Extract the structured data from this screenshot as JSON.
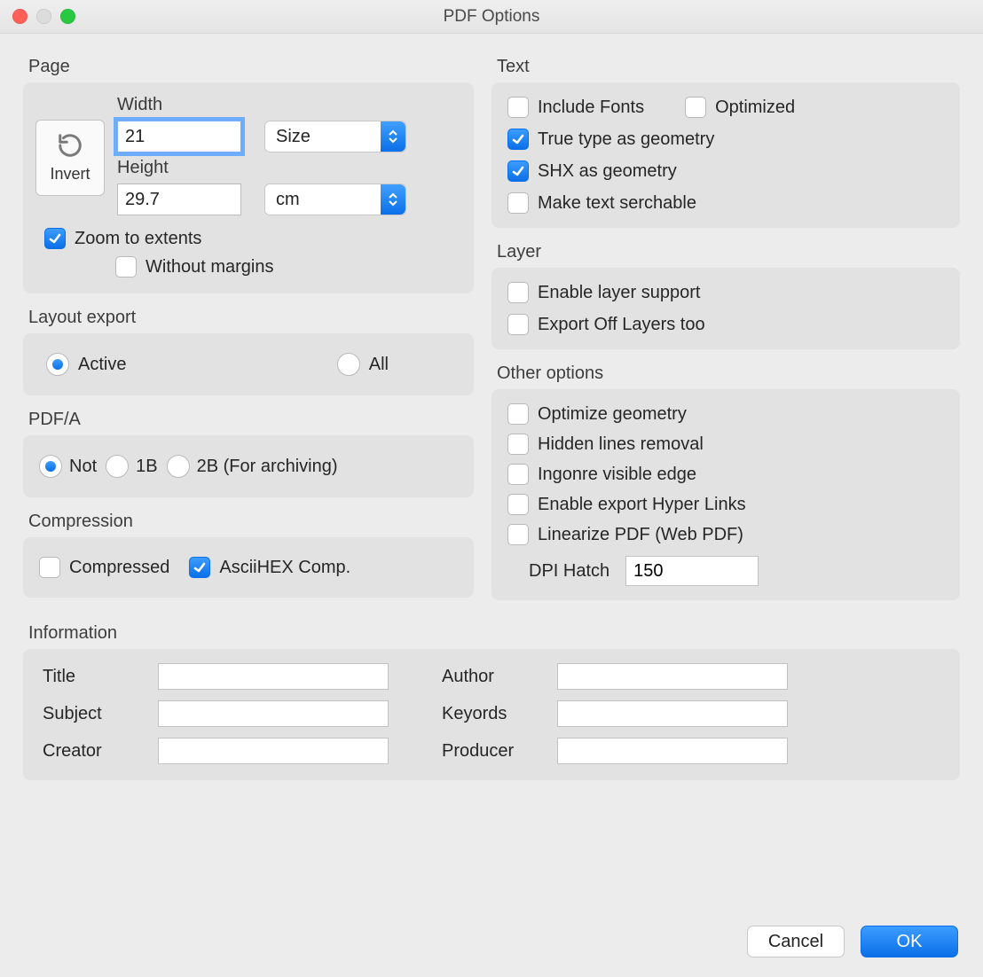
{
  "window": {
    "title": "PDF Options"
  },
  "page": {
    "section": "Page",
    "width_label": "Width",
    "height_label": "Height",
    "width_value": "21",
    "height_value": "29.7",
    "size_select": "Size",
    "unit_select": "cm",
    "invert_label": "Invert",
    "zoom_label": "Zoom to extents",
    "zoom_checked": true,
    "without_margins_label": "Without margins",
    "without_margins_checked": false
  },
  "layout_export": {
    "section": "Layout export",
    "active_label": "Active",
    "all_label": "All",
    "selected": "active"
  },
  "pdfa": {
    "section": "PDF/A",
    "not_label": "Not",
    "b1_label": "1B",
    "b2_label": "2B (For archiving)",
    "selected": "not"
  },
  "compression": {
    "section": "Compression",
    "compressed_label": "Compressed",
    "compressed_checked": false,
    "ascii_label": "AsciiHEX Comp.",
    "ascii_checked": true
  },
  "text": {
    "section": "Text",
    "include_fonts_label": "Include Fonts",
    "include_fonts_checked": false,
    "optimized_label": "Optimized",
    "optimized_checked": false,
    "ttf_label": "True type as geometry",
    "ttf_checked": true,
    "shx_label": "SHX as geometry",
    "shx_checked": true,
    "searchable_label": "Make text serchable",
    "searchable_checked": false
  },
  "layer": {
    "section": "Layer",
    "enable_label": "Enable layer support",
    "enable_checked": false,
    "export_off_label": "Export Off Layers too",
    "export_off_checked": false
  },
  "other": {
    "section": "Other options",
    "optimize_geom_label": "Optimize geometry",
    "optimize_geom_checked": false,
    "hidden_lines_label": "Hidden lines removal",
    "hidden_lines_checked": false,
    "ignore_edge_label": "Ingonre visible edge",
    "ignore_edge_checked": false,
    "hyperlinks_label": "Enable export Hyper Links",
    "hyperlinks_checked": false,
    "linearize_label": "Linearize PDF (Web PDF)",
    "linearize_checked": false,
    "dpi_label": "DPI Hatch",
    "dpi_value": "150"
  },
  "information": {
    "section": "Information",
    "title_label": "Title",
    "title_value": "",
    "subject_label": "Subject",
    "subject_value": "",
    "creator_label": "Creator",
    "creator_value": "",
    "author_label": "Author",
    "author_value": "",
    "keywords_label": "Keyords",
    "keywords_value": "",
    "producer_label": "Producer",
    "producer_value": ""
  },
  "footer": {
    "cancel": "Cancel",
    "ok": "OK"
  }
}
